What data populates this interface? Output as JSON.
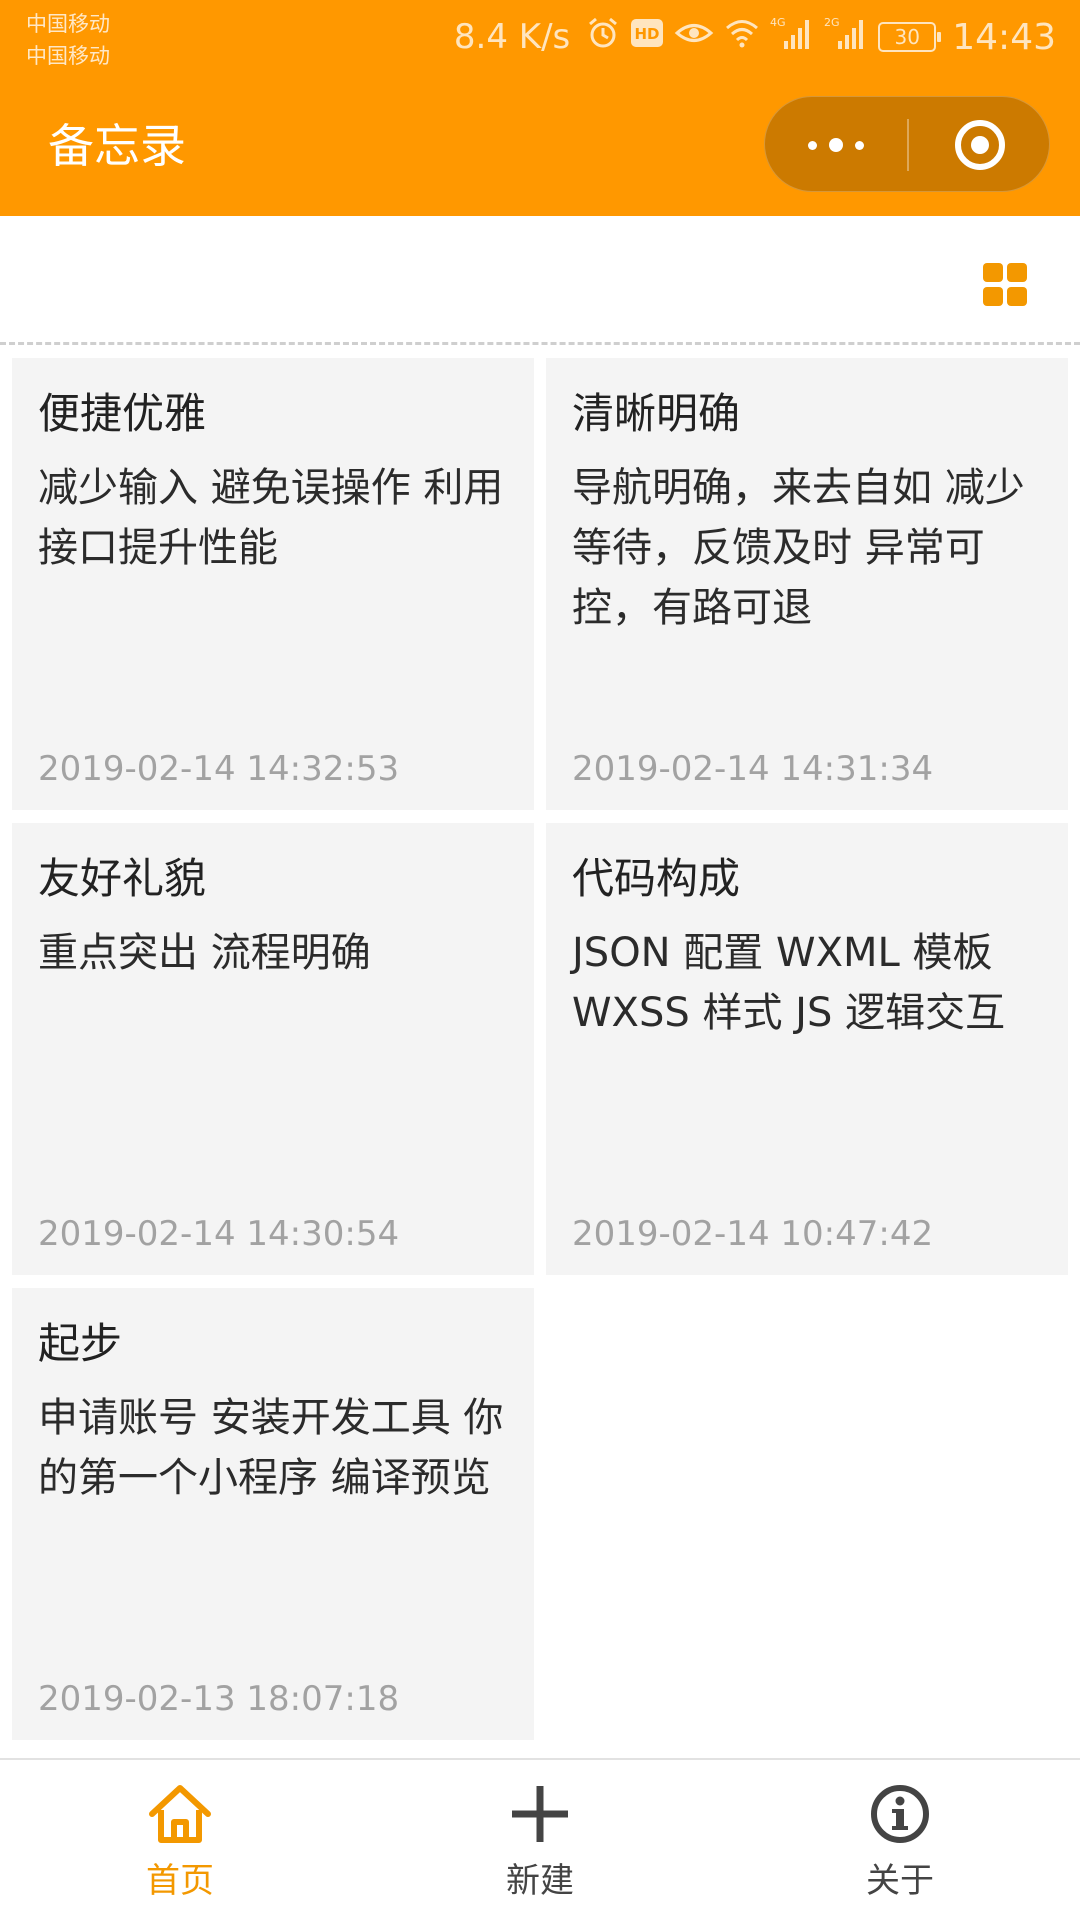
{
  "status_bar": {
    "carrier_1": "中国移动",
    "carrier_2": "中国移动",
    "net_speed": "8.4 K/s",
    "hd_badge": "HD",
    "signal_1_type": "4G",
    "signal_2_type": "2G",
    "battery_level": "30",
    "time": "14:43"
  },
  "nav": {
    "title": "备忘录",
    "more_icon": "more-dots-icon",
    "close_icon": "record-target-icon"
  },
  "toolbar": {
    "view_toggle_icon": "grid-view-icon"
  },
  "memos": [
    {
      "title": "便捷优雅",
      "content": "减少输入 避免误操作 利用接口提升性能",
      "date": "2019-02-14 14:32:53"
    },
    {
      "title": "清晰明确",
      "content": "导航明确，来去自如 减少等待，反馈及时 异常可控，有路可退",
      "date": "2019-02-14 14:31:34"
    },
    {
      "title": "友好礼貌",
      "content": "重点突出 流程明确",
      "date": "2019-02-14 14:30:54"
    },
    {
      "title": "代码构成",
      "content": "JSON 配置 WXML 模板 WXSS 样式 JS 逻辑交互",
      "date": "2019-02-14 10:47:42"
    },
    {
      "title": "起步",
      "content": "申请账号 安装开发工具 你的第一个小程序 编译预览",
      "date": "2019-02-13 18:07:18"
    }
  ],
  "tabbar": {
    "tabs": [
      {
        "label": "首页",
        "icon": "home-icon",
        "active": true
      },
      {
        "label": "新建",
        "icon": "plus-icon",
        "active": false
      },
      {
        "label": "关于",
        "icon": "info-icon",
        "active": false
      }
    ],
    "active_color": "#f39800",
    "inactive_color": "#444444"
  },
  "colors": {
    "brand": "#ff9800",
    "card_background": "#f4f4f4",
    "date_text": "#a2a2a2"
  }
}
